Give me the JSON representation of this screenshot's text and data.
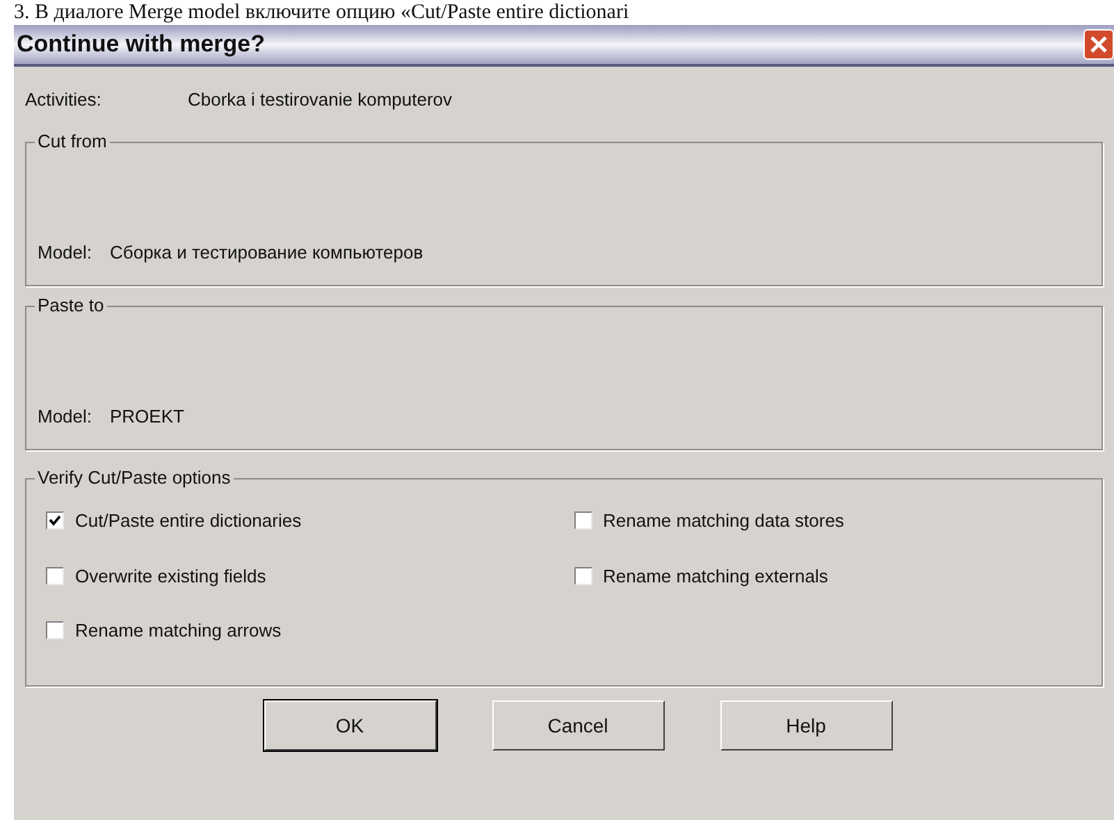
{
  "caption": "3. В диалоге Merge model включите опцию «Cut/Paste entire dictionari",
  "window": {
    "title": "Continue with merge?"
  },
  "activities": {
    "label": "Activities:",
    "value": "Cborka i  testirovanie komputerov"
  },
  "groups": [
    {
      "title": "Cut from",
      "label": "Model:",
      "value": "Сборка и тестирование компьютеров"
    },
    {
      "title": "Paste to",
      "label": "Model:",
      "value": "PROEKT"
    }
  ],
  "options_group": {
    "title": "Verify Cut/Paste options",
    "options": [
      {
        "label": "Cut/Paste entire dictionaries",
        "checked": true
      },
      {
        "label": "Overwrite existing fields",
        "checked": false
      },
      {
        "label": "Rename matching arrows",
        "checked": false
      },
      {
        "label": "Rename matching data stores",
        "checked": false
      },
      {
        "label": "Rename matching externals",
        "checked": false
      }
    ]
  },
  "buttons": [
    {
      "label": "OK",
      "default": true
    },
    {
      "label": "Cancel",
      "default": false
    },
    {
      "label": "Help",
      "default": false
    }
  ]
}
